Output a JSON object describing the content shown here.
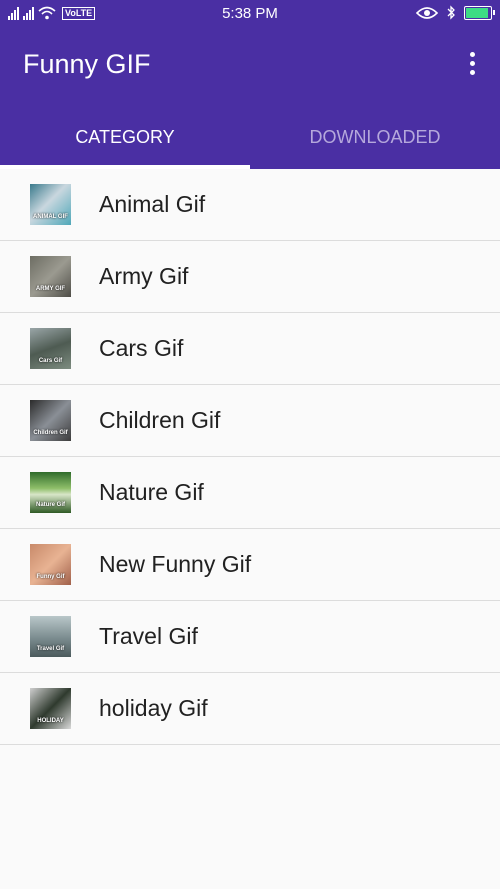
{
  "status_bar": {
    "time": "5:38 PM",
    "network_badge": "VoLTE",
    "icons": [
      "signal-icon",
      "signal-icon",
      "wifi-icon",
      "eye-icon",
      "bluetooth-icon",
      "battery-charging-icon"
    ],
    "battery_level": 0.85
  },
  "app_bar": {
    "title": "Funny GIF",
    "menu_icon": "more-vert-icon"
  },
  "tabs": [
    {
      "label": "CATEGORY",
      "selected": true
    },
    {
      "label": "DOWNLOADED",
      "selected": false
    }
  ],
  "colors": {
    "primary": "#4a2fa3",
    "background": "#fafafa",
    "divider": "#dcdcdc",
    "tab_inactive": "#b5a8dc"
  },
  "categories": [
    {
      "label": "Animal Gif",
      "thumb_caption": "ANIMAL GIF"
    },
    {
      "label": "Army Gif",
      "thumb_caption": "ARMY GIF"
    },
    {
      "label": "Cars Gif",
      "thumb_caption": "Cars Gif"
    },
    {
      "label": "Children Gif",
      "thumb_caption": "Children Gif"
    },
    {
      "label": "Nature Gif",
      "thumb_caption": "Nature Gif"
    },
    {
      "label": "New Funny Gif",
      "thumb_caption": "Funny Gif"
    },
    {
      "label": "Travel Gif",
      "thumb_caption": "Travel Gif"
    },
    {
      "label": "holiday Gif",
      "thumb_caption": "HOLIDAY"
    }
  ]
}
